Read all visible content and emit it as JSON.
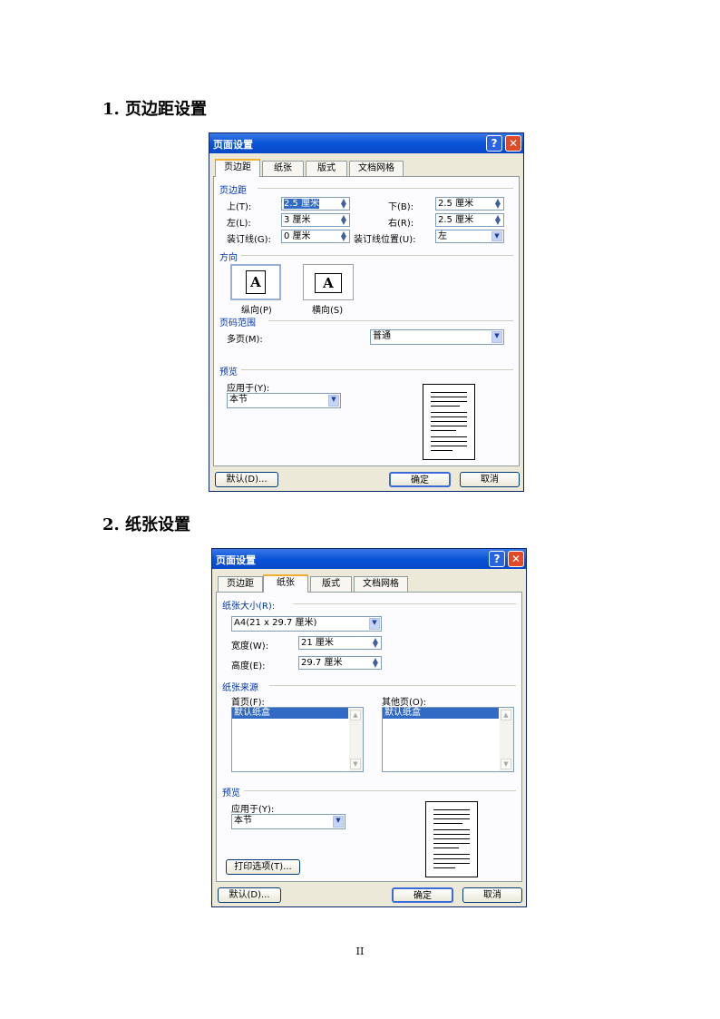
{
  "section1": {
    "heading": "1. 页边距设置"
  },
  "section2": {
    "heading": "2. 纸张设置"
  },
  "dialog1": {
    "title": "页面设置",
    "tabs": [
      "页边距",
      "纸张",
      "版式",
      "文档网格"
    ],
    "margins_group": "页边距",
    "top_label": "上(T):",
    "top_value": "2.5 厘米",
    "bottom_label": "下(B):",
    "bottom_value": "2.5 厘米",
    "left_label": "左(L):",
    "left_value": "3 厘米",
    "right_label": "右(R):",
    "right_value": "2.5 厘米",
    "gutter_label": "装订线(G):",
    "gutter_value": "0 厘米",
    "gutter_pos_label": "装订线位置(U):",
    "gutter_pos_value": "左",
    "orientation_group": "方向",
    "portrait_label": "纵向(P)",
    "landscape_label": "横向(S)",
    "page_glyph": "A",
    "pages_group": "页码范围",
    "multiple_pages_label": "多页(M):",
    "multiple_pages_value": "普通",
    "preview_group": "预览",
    "apply_to_label": "应用于(Y):",
    "apply_to_value": "本节",
    "default_button": "默认(D)...",
    "ok_button": "确定",
    "cancel_button": "取消"
  },
  "dialog2": {
    "title": "页面设置",
    "tabs": [
      "页边距",
      "纸张",
      "版式",
      "文档网格"
    ],
    "paper_size_group": "纸张大小(R):",
    "paper_size_value": "A4(21 x 29.7 厘米)",
    "width_label": "宽度(W):",
    "width_value": "21 厘米",
    "height_label": "高度(E):",
    "height_value": "29.7 厘米",
    "paper_source_group": "纸张来源",
    "first_page_label": "首页(F):",
    "first_page_item": "默认纸盒",
    "other_pages_label": "其他页(O):",
    "other_pages_item": "默认纸盒",
    "preview_group": "预览",
    "apply_to_label": "应用于(Y):",
    "apply_to_value": "本节",
    "print_options_button": "打印选项(T)...",
    "default_button": "默认(D)...",
    "ok_button": "确定",
    "cancel_button": "取消"
  },
  "footer": {
    "page_number": "II"
  }
}
